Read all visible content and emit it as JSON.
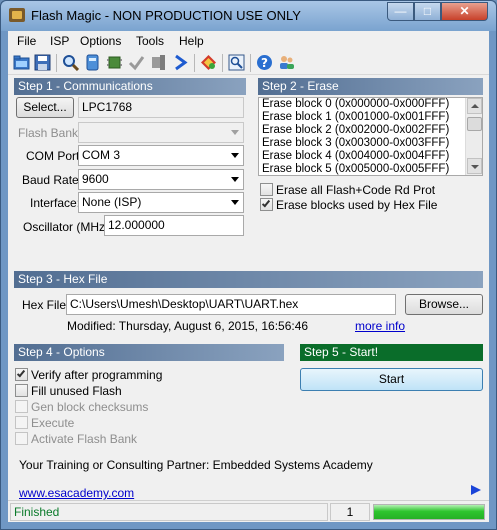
{
  "window": {
    "title": "Flash Magic - NON PRODUCTION USE ONLY",
    "controls": {
      "minimize": "—",
      "maximize": "□",
      "close": "✕"
    }
  },
  "menu": [
    "File",
    "ISP",
    "Options",
    "Tools",
    "Help"
  ],
  "toolbar": {
    "icons": [
      "open-icon",
      "save-icon",
      "search-icon",
      "memory-icon",
      "chip-icon",
      "check-icon",
      "device-icon",
      "run-icon",
      "diamond-icon",
      "zoom-window-icon",
      "help-icon",
      "users-icon"
    ]
  },
  "step1": {
    "header": "Step 1 - Communications",
    "select_button": "Select...",
    "device": "LPC1768",
    "flash_bank_label": "Flash Bank:",
    "flash_bank_value": "",
    "com_port_label": "COM Port:",
    "com_port_value": "COM 3",
    "baud_rate_label": "Baud Rate:",
    "baud_rate_value": "9600",
    "interface_label": "Interface:",
    "interface_value": "None (ISP)",
    "oscillator_label": "Oscillator (MHz):",
    "oscillator_value": "12.000000"
  },
  "step2": {
    "header": "Step 2 - Erase",
    "blocks": [
      "Erase block 0 (0x000000-0x000FFF)",
      "Erase block 1 (0x001000-0x001FFF)",
      "Erase block 2 (0x002000-0x002FFF)",
      "Erase block 3 (0x003000-0x003FFF)",
      "Erase block 4 (0x004000-0x004FFF)",
      "Erase block 5 (0x005000-0x005FFF)"
    ],
    "erase_all_label": "Erase all Flash+Code Rd Prot",
    "erase_all_checked": false,
    "erase_used_label": "Erase blocks used by Hex File",
    "erase_used_checked": true
  },
  "step3": {
    "header": "Step 3 - Hex File",
    "hex_label": "Hex File:",
    "hex_path": "C:\\Users\\Umesh\\Desktop\\UART\\UART.hex",
    "browse_button": "Browse...",
    "modified_text": "Modified: Thursday, August 6, 2015, 16:56:46",
    "more_info": "more info"
  },
  "step4": {
    "header": "Step 4 - Options",
    "options": [
      {
        "label": "Verify after programming",
        "checked": true,
        "enabled": true
      },
      {
        "label": "Fill unused Flash",
        "checked": false,
        "enabled": true
      },
      {
        "label": "Gen block checksums",
        "checked": false,
        "enabled": false
      },
      {
        "label": "Execute",
        "checked": false,
        "enabled": false
      },
      {
        "label": "Activate Flash Bank",
        "checked": false,
        "enabled": false
      }
    ]
  },
  "step5": {
    "header": "Step 5 - Start!",
    "start_button": "Start"
  },
  "partner_text": "Your Training or Consulting Partner: Embedded Systems Academy",
  "website": "www.esacademy.com",
  "status": {
    "text": "Finished",
    "count": "1",
    "progress": 1.0
  },
  "colors": {
    "panel_header": "#526e92",
    "step5_header": "#0a6d2a",
    "progress_fill": "#2ec52e",
    "link": "#0000cc"
  }
}
